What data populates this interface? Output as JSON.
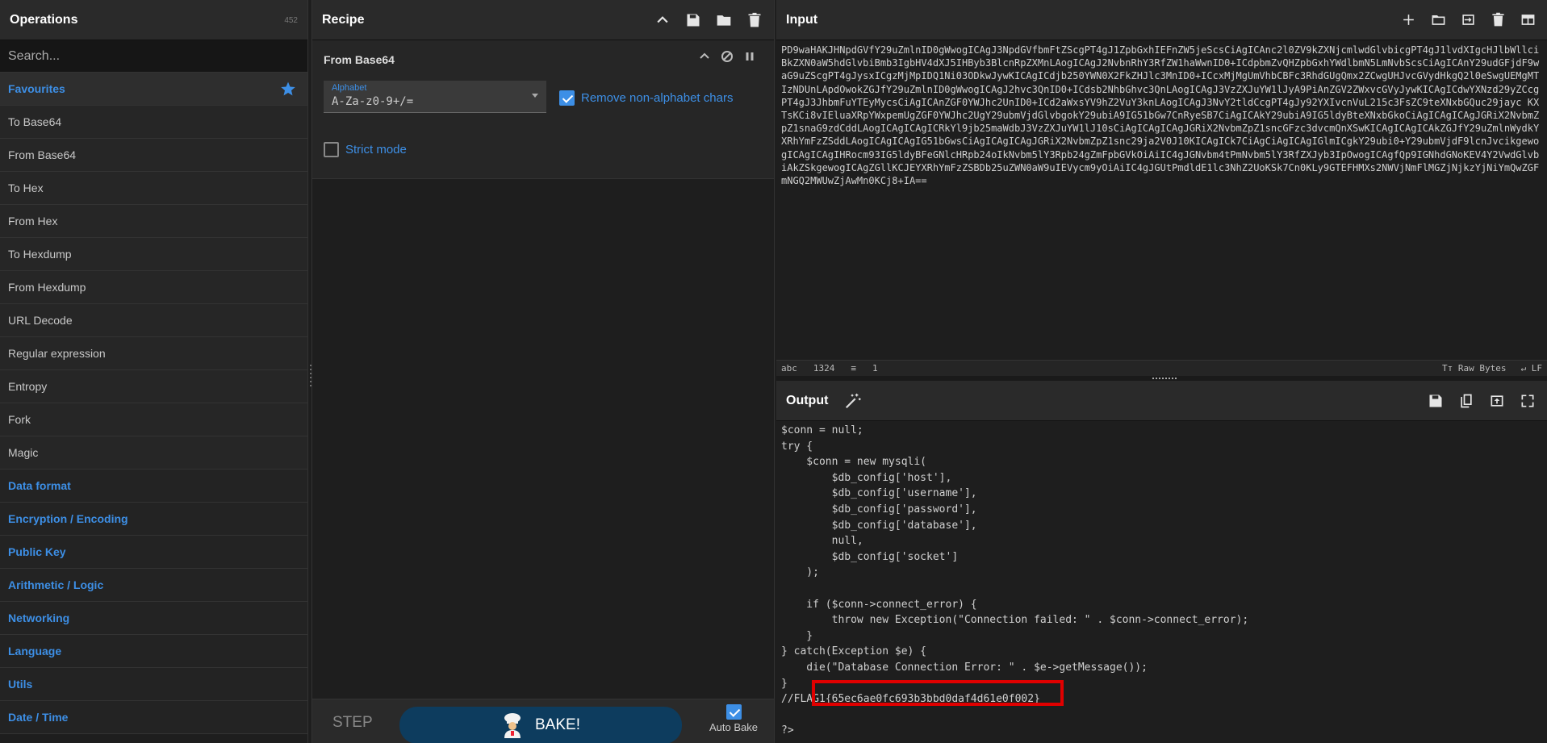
{
  "operations": {
    "title": "Operations",
    "count": "452",
    "search_placeholder": "Search...",
    "favourites": "Favourites",
    "items": [
      "To Base64",
      "From Base64",
      "To Hex",
      "From Hex",
      "To Hexdump",
      "From Hexdump",
      "URL Decode",
      "Regular expression",
      "Entropy",
      "Fork",
      "Magic"
    ],
    "categories": [
      "Data format",
      "Encryption / Encoding",
      "Public Key",
      "Arithmetic / Logic",
      "Networking",
      "Language",
      "Utils",
      "Date / Time"
    ]
  },
  "recipe": {
    "title": "Recipe",
    "operation": {
      "name": "From Base64",
      "alphabet_label": "Alphabet",
      "alphabet_value": "A-Za-z0-9+/=",
      "remove_nonalpha_label": "Remove non-alphabet chars",
      "remove_nonalpha_checked": true,
      "strict_mode_label": "Strict mode",
      "strict_mode_checked": false
    },
    "footer": {
      "step_label": "STEP",
      "bake_label": "BAKE!",
      "autobake_label": "Auto Bake",
      "autobake_checked": true
    }
  },
  "input": {
    "title": "Input",
    "text": "PD9waHAKJHNpdGVfY29uZmlnID0gWwogICAgJ3NpdGVfbmFtZScgPT4gJ1ZpbGxhIEFnZW5jeScsCiAgICAnc2l0ZV9kZXNjcmlwdGlvbicgPT4gJ1lvdXIgcHJlbWllciBkZXN0aW5hdGlvbiBmb3IgbHV4dXJ5IHByb3BlcnRpZXMnLAogICAgJ2NvbnRhY3RfZW1haWwnID0+ICdpbmZvQHZpbGxhYWdlbmN5LmNvbScsCiAgICAnY29udGFjdF9waG9uZScgPT4gJysxICgzMjMpIDQ1Ni03ODkwJywKICAgICdjb250YWN0X2FkZHJlc3MnID0+ICcxMjMgUmVhbCBFc3RhdGUgQmx2ZCwgUHJvcGVydHkgQ2l0eSwgUEMgMTIzNDUnLApdOwokZGJfY29uZmlnID0gWwogICAgJ2hvc3QnID0+ICdsb2NhbGhvc3QnLAogICAgJ3VzZXJuYW1lJyA9PiAnZGV2ZWxvcGVyJywKICAgICdwYXNzd29yZCcgPT4gJ3JhbmFuYTEyMycsCiAgICAnZGF0YWJhc2UnID0+ICd2aWxsYV9hZ2VuY3knLAogICAgJ3NvY2tldCcgPT4gJy92YXIvcnVuL215c3FsZC9teXNxbGQuc29jayc KXTsKCi8vIEluaXRpYWxpemUgZGF0YWJhc2UgY29ubmVjdGlvbgokY29ubiA9IG51bGw7CnRyeSB7CiAgICAkY29ubiA9IG5ldyBteXNxbGkoCiAgICAgICAgJGRiX2NvbmZpZ1snaG9zdCddLAogICAgICAgICRkYl9jb25maWdbJ3VzZXJuYW1lJ10sCiAgICAgICAgJGRiX2NvbmZpZ1sncGFzc3dvcmQnXSwKICAgICAgICAkZGJfY29uZmlnWydkYXRhYmFzZSddLAogICAgICAgIG51bGwsCiAgICAgICAgJGRiX2NvbmZpZ1snc29ja2V0J10KICAgICk7CiAgCiAgICAgIGlmICgkY29ubi0+Y29ubmVjdF9lcnJvcikgewogICAgICAgIHRocm93IG5ldyBFeGNlcHRpb24oIkNvbm5lY3Rpb24gZmFpbGVkOiAiIC4gJGNvbm4tPmNvbm5lY3RfZXJyb3IpOwogICAgfQp9IGNhdGNoKEV4Y2VwdGlvbiAkZSkgewogICAgZGllKCJEYXRhYmFzZSBDb25uZWN0aW9uIEVycm9yOiAiIC4gJGUtPmdldE1lc3NhZ2UoKSk7Cn0KLy9GTEFHMXs2NWVjNmFlMGZjNjkzYjNiYmQwZGFmNGQ2MWUwZjAwMn0KCj8+IA==",
    "char_count": "1324",
    "line_count": "1",
    "raw_bytes_label": "Raw Bytes",
    "eol_label": "LF"
  },
  "output": {
    "title": "Output",
    "text": "$conn = null;\ntry {\n    $conn = new mysqli(\n        $db_config['host'],\n        $db_config['username'],\n        $db_config['password'],\n        $db_config['database'],\n        null,\n        $db_config['socket']\n    );\n\n    if ($conn->connect_error) {\n        throw new Exception(\"Connection failed: \" . $conn->connect_error);\n    }\n} catch(Exception $e) {\n    die(\"Database Connection Error: \" . $e->getMessage());\n}\n//FLAG1{65ec6ae0fc693b3bbd0daf4d61e0f002}\n\n?>"
  },
  "colors": {
    "accent": "#3d8fe6",
    "highlight": "#e00000",
    "bake_button": "#0d3c5e"
  }
}
